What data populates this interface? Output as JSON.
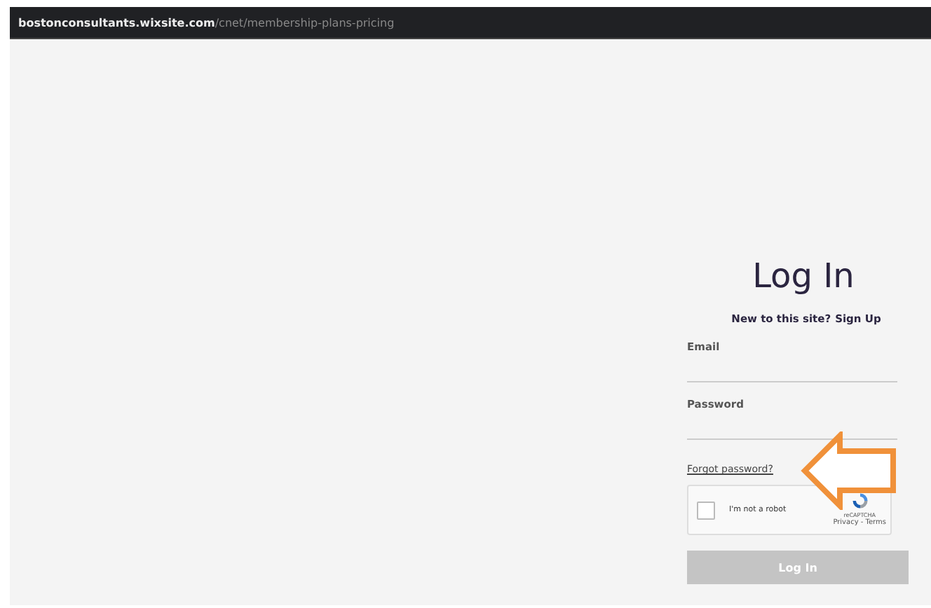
{
  "address_bar": {
    "domain": "bostonconsultants.wixsite.com",
    "path": "/cnet/membership-plans-pricing"
  },
  "login": {
    "title": "Log In",
    "signup_prompt": "New to this site?",
    "signup_link": "Sign Up",
    "fields": [
      {
        "label": "Email"
      },
      {
        "label": "Password"
      }
    ],
    "forgot_link": "Forgot password?",
    "captcha": {
      "checked": false,
      "label": "I'm not a robot",
      "brand": "reCAPTCHA",
      "links": "Privacy - Terms"
    },
    "submit": {
      "label": "Log In",
      "disabled": true
    }
  }
}
